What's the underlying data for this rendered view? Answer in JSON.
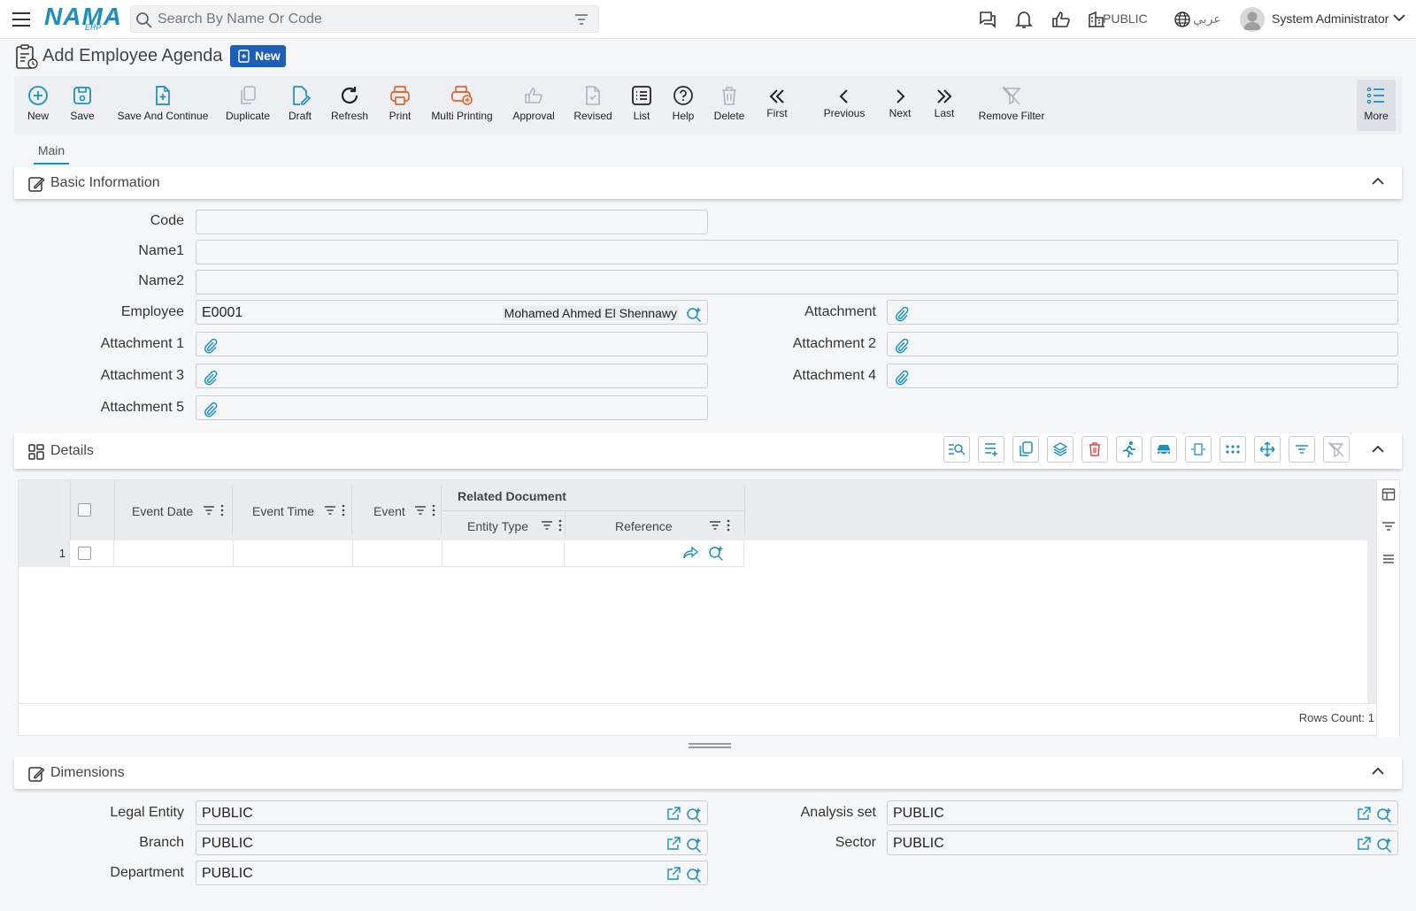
{
  "header": {
    "logo_text": "NAMA",
    "logo_sub": "ERP",
    "search_placeholder": "Search By Name Or Code",
    "company": "PUBLIC",
    "language": "عربي",
    "user": "System Administrator"
  },
  "page": {
    "title": "Add Employee Agenda",
    "badge": "New"
  },
  "toolbar": {
    "new": "New",
    "save": "Save",
    "save_continue": "Save And Continue",
    "duplicate": "Duplicate",
    "draft": "Draft",
    "refresh": "Refresh",
    "print": "Print",
    "multi_printing": "Multi Printing",
    "approval": "Approval",
    "revised": "Revised",
    "list": "List",
    "help": "Help",
    "delete": "Delete",
    "first": "First",
    "previous": "Previous",
    "next": "Next",
    "last": "Last",
    "remove_filter": "Remove Filter",
    "more": "More"
  },
  "tabs": {
    "main": "Main"
  },
  "basic": {
    "title": "Basic Information",
    "code_label": "Code",
    "code_value": "",
    "name1_label": "Name1",
    "name1_value": "",
    "name2_label": "Name2",
    "name2_value": "",
    "employee_label": "Employee",
    "employee_code": "E0001",
    "employee_name": "Mohamed Ahmed El Shennawy",
    "attachment_label": "Attachment",
    "attachment1_label": "Attachment 1",
    "attachment2_label": "Attachment 2",
    "attachment3_label": "Attachment 3",
    "attachment4_label": "Attachment 4",
    "attachment5_label": "Attachment 5"
  },
  "details": {
    "title": "Details",
    "columns": {
      "event_date": "Event Date",
      "event_time": "Event Time",
      "event": "Event",
      "related_document": "Related Document",
      "entity_type": "Entity Type",
      "reference": "Reference"
    },
    "rows": [
      {
        "num": "1",
        "event_date": "",
        "event_time": "",
        "event": "",
        "entity_type": "",
        "reference": ""
      }
    ],
    "rows_count": "Rows Count: 1"
  },
  "dimensions": {
    "title": "Dimensions",
    "legal_entity_label": "Legal Entity",
    "legal_entity_value": "PUBLIC",
    "branch_label": "Branch",
    "branch_value": "PUBLIC",
    "department_label": "Department",
    "department_value": "PUBLIC",
    "analysis_set_label": "Analysis set",
    "analysis_set_value": "PUBLIC",
    "sector_label": "Sector",
    "sector_value": "PUBLIC"
  },
  "colors": {
    "accent": "#1b8fc0",
    "badge": "#1d5fb8",
    "print": "#e3642a",
    "danger": "#e04848"
  }
}
